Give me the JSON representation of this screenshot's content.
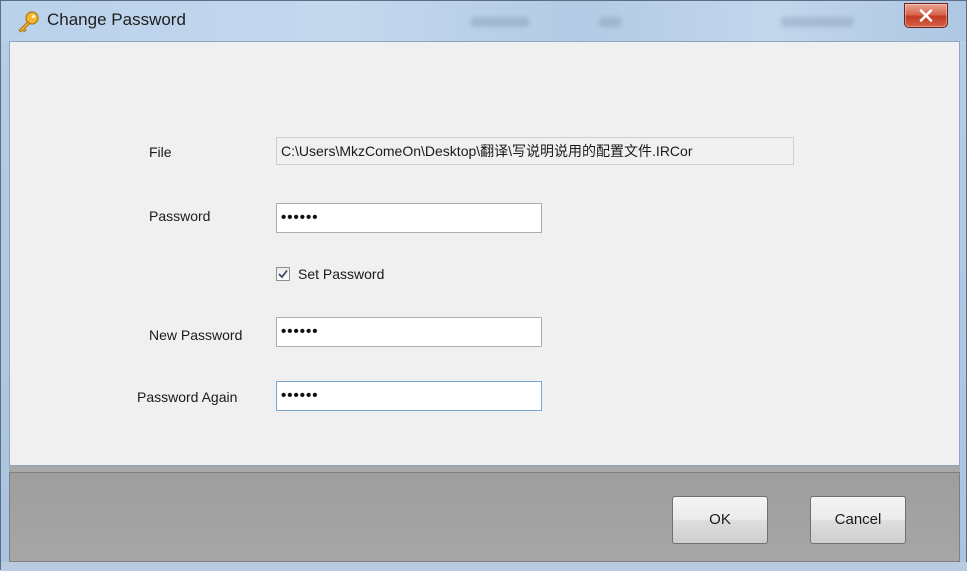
{
  "window": {
    "title": "Change Password",
    "icon": "key-icon",
    "close_icon": "close-icon"
  },
  "form": {
    "file": {
      "label": "File",
      "value": "C:\\Users\\MkzComeOn\\Desktop\\翻译\\写说明说用的配置文件.IRCor"
    },
    "password": {
      "label": "Password",
      "value": "••••••"
    },
    "set_password": {
      "label": "Set Password",
      "checked": true
    },
    "new_password": {
      "label": "New Password",
      "value": "••••••"
    },
    "password_again": {
      "label": "Password Again",
      "value": "••••••"
    }
  },
  "buttons": {
    "ok": "OK",
    "cancel": "Cancel"
  },
  "colors": {
    "close_button": "#c8442a",
    "content_background": "#f0f0f0",
    "footer_background": "#a3a3a3"
  }
}
